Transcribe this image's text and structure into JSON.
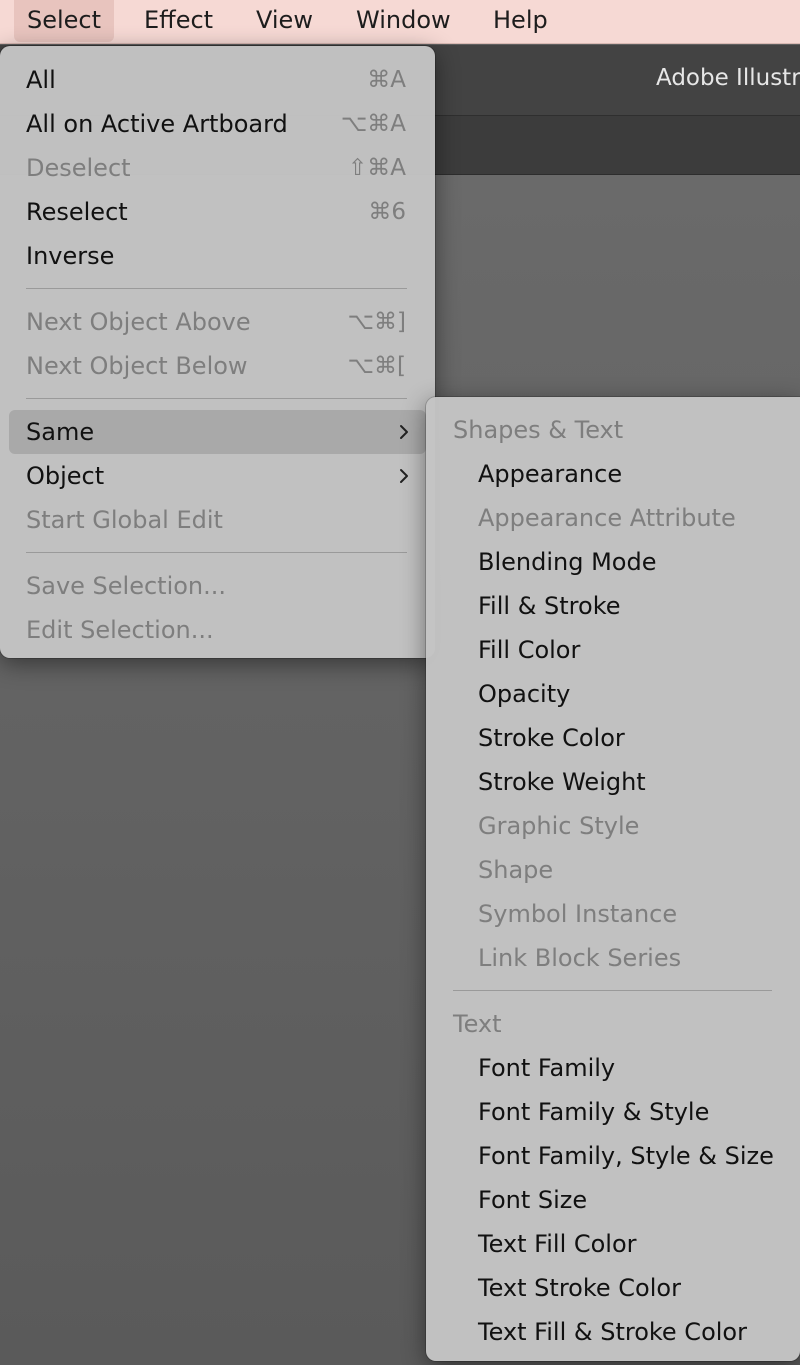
{
  "menubar": {
    "items": [
      "Select",
      "Effect",
      "View",
      "Window",
      "Help"
    ],
    "active": "Select"
  },
  "app": {
    "title": "Adobe Illustr"
  },
  "select_menu": {
    "groups": [
      [
        {
          "label": "All",
          "shortcut": "⌘A",
          "enabled": true
        },
        {
          "label": "All on Active Artboard",
          "shortcut": "⌥⌘A",
          "enabled": true
        },
        {
          "label": "Deselect",
          "shortcut": "⇧⌘A",
          "enabled": false
        },
        {
          "label": "Reselect",
          "shortcut": "⌘6",
          "enabled": true
        },
        {
          "label": "Inverse",
          "shortcut": "",
          "enabled": true
        }
      ],
      [
        {
          "label": "Next Object Above",
          "shortcut": "⌥⌘]",
          "enabled": false
        },
        {
          "label": "Next Object Below",
          "shortcut": "⌥⌘[",
          "enabled": false
        }
      ],
      [
        {
          "label": "Same",
          "submenu": true,
          "enabled": true,
          "highlighted": true
        },
        {
          "label": "Object",
          "submenu": true,
          "enabled": true
        },
        {
          "label": "Start Global Edit",
          "shortcut": "",
          "enabled": false
        }
      ],
      [
        {
          "label": "Save Selection...",
          "shortcut": "",
          "enabled": false
        },
        {
          "label": "Edit Selection...",
          "shortcut": "",
          "enabled": false
        }
      ]
    ]
  },
  "same_submenu": {
    "sections": [
      {
        "header": "Shapes & Text",
        "items": [
          {
            "label": "Appearance",
            "enabled": true
          },
          {
            "label": "Appearance Attribute",
            "enabled": false
          },
          {
            "label": "Blending Mode",
            "enabled": true
          },
          {
            "label": "Fill & Stroke",
            "enabled": true
          },
          {
            "label": "Fill Color",
            "enabled": true
          },
          {
            "label": "Opacity",
            "enabled": true
          },
          {
            "label": "Stroke Color",
            "enabled": true
          },
          {
            "label": "Stroke Weight",
            "enabled": true
          },
          {
            "label": "Graphic Style",
            "enabled": false
          },
          {
            "label": "Shape",
            "enabled": false
          },
          {
            "label": "Symbol Instance",
            "enabled": false
          },
          {
            "label": "Link Block Series",
            "enabled": false
          }
        ]
      },
      {
        "header": "Text",
        "items": [
          {
            "label": "Font Family",
            "enabled": true
          },
          {
            "label": "Font Family & Style",
            "enabled": true
          },
          {
            "label": "Font Family, Style & Size",
            "enabled": true
          },
          {
            "label": "Font Size",
            "enabled": true
          },
          {
            "label": "Text Fill Color",
            "enabled": true
          },
          {
            "label": "Text Stroke Color",
            "enabled": true
          },
          {
            "label": "Text Fill & Stroke Color",
            "enabled": true
          }
        ]
      }
    ]
  }
}
